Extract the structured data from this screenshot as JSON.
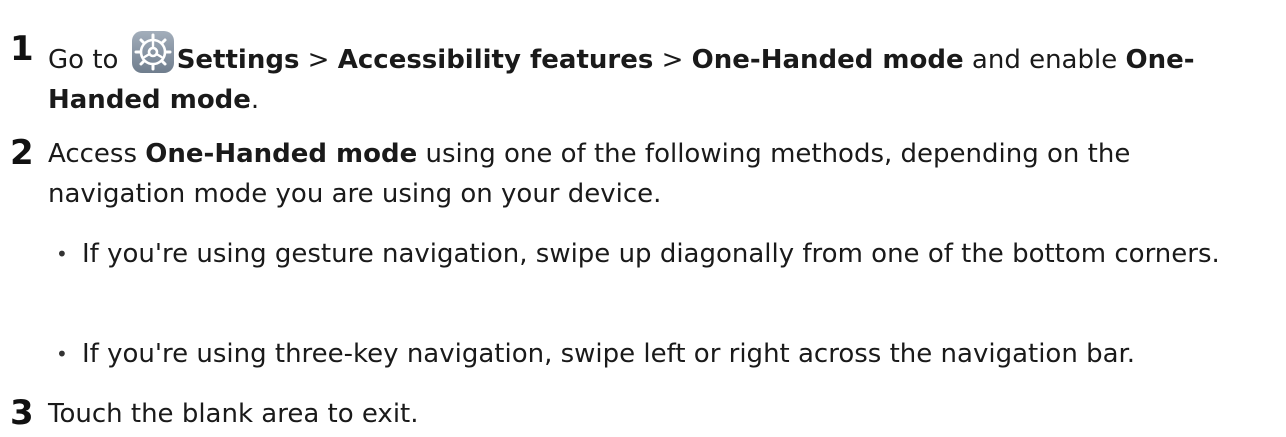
{
  "steps": [
    {
      "number": "1",
      "parts": {
        "t1": "Go to ",
        "icon": "settings-gear-icon",
        "b1": "Settings",
        "t2": " > ",
        "b2": "Accessibility features",
        "t3": " > ",
        "b3": "One-Handed mode",
        "t4": " and enable ",
        "b4": "One-Handed mode",
        "t5": "."
      }
    },
    {
      "number": "2",
      "parts": {
        "t1": "Access ",
        "b1": "One-Handed mode",
        "t2": " using one of the following methods, depending on the navigation mode you are using on your device."
      },
      "bullets": [
        "If you're using gesture navigation, swipe up diagonally from one of the bottom corners.",
        "If you're using three-key navigation, swipe left or right across the navigation bar."
      ]
    },
    {
      "number": "3",
      "parts": {
        "t1": "Touch the blank area to exit."
      }
    }
  ],
  "bullet_symbol": "•",
  "colors": {
    "text": "#1a1a1a",
    "icon_bg": "#8a97a6",
    "icon_fg": "#ffffff"
  }
}
